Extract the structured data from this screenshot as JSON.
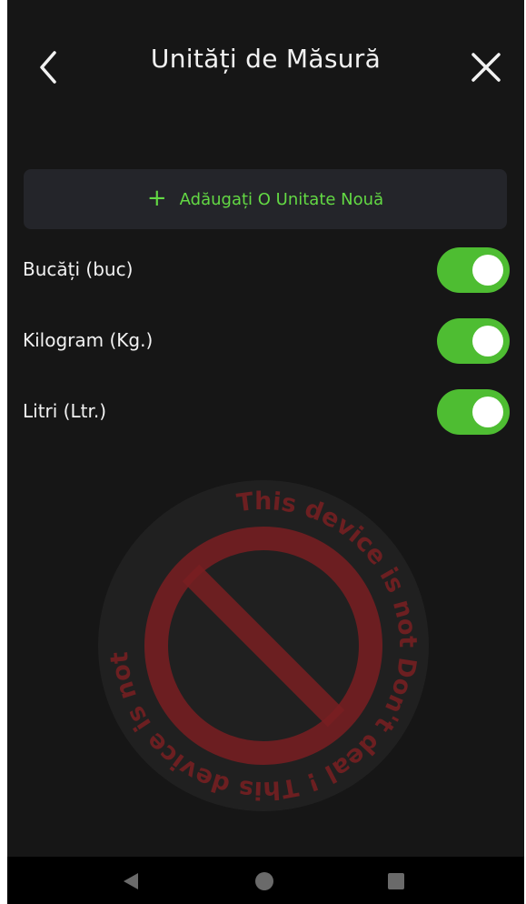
{
  "header": {
    "title": "Unități de Măsură",
    "back_icon": "chevron-left-icon",
    "close_icon": "close-icon"
  },
  "add_unit": {
    "icon": "plus-icon",
    "label": "Adăugați O Unitate Nouă"
  },
  "units": [
    {
      "label": "Bucăți (buc)",
      "enabled": true
    },
    {
      "label": "Kilogram (Kg.)",
      "enabled": true
    },
    {
      "label": "Litri (Ltr.)",
      "enabled": true
    }
  ],
  "watermark": {
    "text": "This device is not  Don't deal !",
    "icon": "prohibited-icon"
  },
  "system_nav": {
    "back_icon": "triangle-back-icon",
    "home_icon": "circle-home-icon",
    "recents_icon": "square-recents-icon"
  },
  "colors": {
    "background": "#161616",
    "accent_green": "#63d944",
    "toggle_on": "#4ebd32",
    "button_bg": "#24252a",
    "watermark_red": "#7a1f22"
  }
}
